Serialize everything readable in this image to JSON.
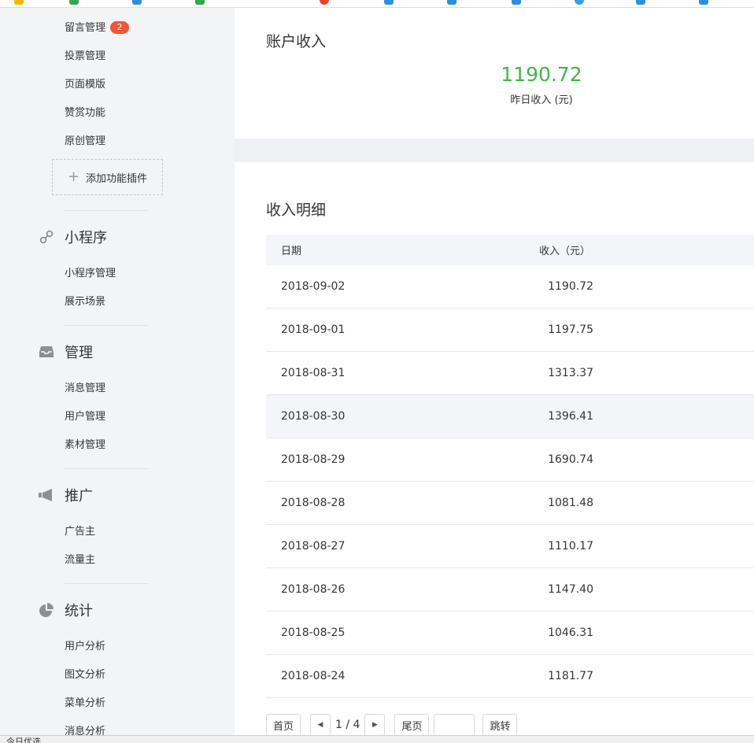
{
  "sidebar": {
    "group_function": {
      "items": [
        {
          "label": "留言管理",
          "badge": "2"
        },
        {
          "label": "投票管理"
        },
        {
          "label": "页面模版"
        },
        {
          "label": "赞赏功能"
        },
        {
          "label": "原创管理"
        }
      ],
      "add_plugin": {
        "icon": "plus-icon",
        "label": "添加功能插件"
      }
    },
    "group_miniprogram": {
      "icon": "link-icon",
      "title": "小程序",
      "items": [
        {
          "label": "小程序管理"
        },
        {
          "label": "展示场景"
        }
      ]
    },
    "group_manage": {
      "icon": "inbox-icon",
      "title": "管理",
      "items": [
        {
          "label": "消息管理"
        },
        {
          "label": "用户管理"
        },
        {
          "label": "素材管理"
        }
      ]
    },
    "group_promote": {
      "icon": "megaphone-icon",
      "title": "推广",
      "items": [
        {
          "label": "广告主"
        },
        {
          "label": "流量主"
        }
      ]
    },
    "group_stats": {
      "icon": "pie-chart-icon",
      "title": "统计",
      "items": [
        {
          "label": "用户分析"
        },
        {
          "label": "图文分析"
        },
        {
          "label": "菜单分析"
        },
        {
          "label": "消息分析"
        }
      ]
    }
  },
  "account_income": {
    "title": "账户收入",
    "yesterday_amount": "1190.72",
    "yesterday_label": "昨日收入 (元)"
  },
  "income_detail": {
    "title": "收入明细",
    "columns": {
      "date": "日期",
      "amount": "收入（元）"
    },
    "rows": [
      {
        "date": "2018-09-02",
        "amount": "1190.72"
      },
      {
        "date": "2018-09-01",
        "amount": "1197.75"
      },
      {
        "date": "2018-08-31",
        "amount": "1313.37"
      },
      {
        "date": "2018-08-30",
        "amount": "1396.41"
      },
      {
        "date": "2018-08-29",
        "amount": "1690.74"
      },
      {
        "date": "2018-08-28",
        "amount": "1081.48"
      },
      {
        "date": "2018-08-27",
        "amount": "1110.17"
      },
      {
        "date": "2018-08-26",
        "amount": "1147.40"
      },
      {
        "date": "2018-08-25",
        "amount": "1046.31"
      },
      {
        "date": "2018-08-24",
        "amount": "1181.77"
      }
    ]
  },
  "pagination": {
    "first": "首页",
    "prev_icon": "caret-left-icon",
    "page_indicator": "1 / 4",
    "next_icon": "caret-right-icon",
    "last": "尾页",
    "jump_value": "",
    "jump": "跳转"
  },
  "status_bar": {
    "text": "今日优选"
  },
  "colors": {
    "accent_green": "#44b549",
    "badge_red": "#f15533"
  }
}
